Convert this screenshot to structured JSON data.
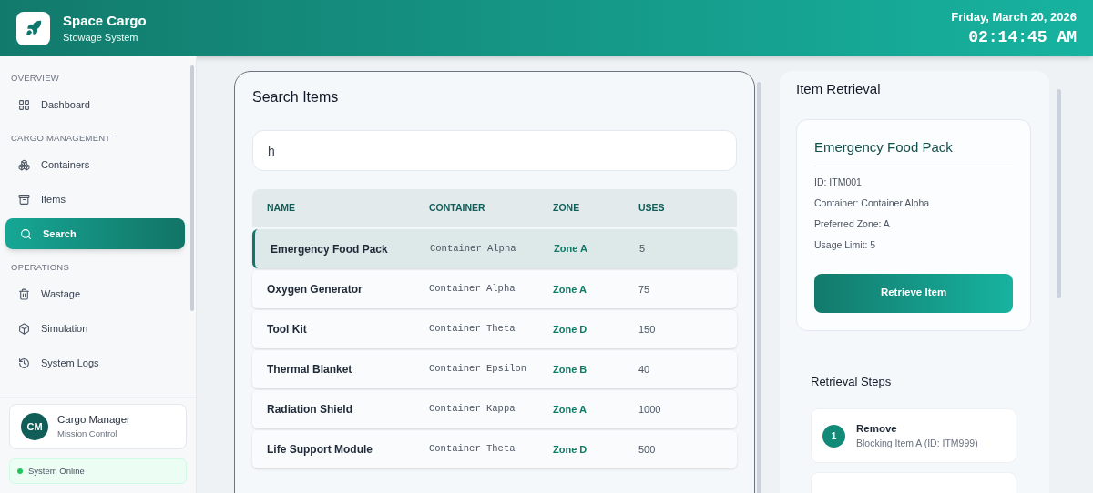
{
  "header": {
    "title": "Space Cargo",
    "subtitle": "Stowage System",
    "date": "Friday, March 20, 2026",
    "time": "02:14:45 AM"
  },
  "sidebar": {
    "sections": [
      {
        "title": "OVERVIEW",
        "items": [
          {
            "label": "Dashboard",
            "selected": false
          }
        ]
      },
      {
        "title": "CARGO MANAGEMENT",
        "items": [
          {
            "label": "Containers",
            "selected": false
          },
          {
            "label": "Items",
            "selected": false
          },
          {
            "label": "Search",
            "selected": true
          }
        ]
      },
      {
        "title": "OPERATIONS",
        "items": [
          {
            "label": "Wastage",
            "selected": false
          },
          {
            "label": "Simulation",
            "selected": false
          },
          {
            "label": "System Logs",
            "selected": false
          }
        ]
      }
    ],
    "user": {
      "initials": "CM",
      "name": "Cargo Manager",
      "role": "Mission Control"
    },
    "status": {
      "label": "System Online",
      "online": true
    }
  },
  "search": {
    "title": "Search Items",
    "value": "h",
    "columns": [
      "NAME",
      "CONTAINER",
      "ZONE",
      "USES"
    ],
    "rows": [
      {
        "name": "Emergency Food Pack",
        "container": "Container Alpha",
        "zone": "Zone A",
        "uses": "5",
        "selected": true
      },
      {
        "name": "Oxygen Generator",
        "container": "Container Alpha",
        "zone": "Zone A",
        "uses": "75",
        "selected": false
      },
      {
        "name": "Tool Kit",
        "container": "Container Theta",
        "zone": "Zone D",
        "uses": "150",
        "selected": false
      },
      {
        "name": "Thermal Blanket",
        "container": "Container Epsilon",
        "zone": "Zone B",
        "uses": "40",
        "selected": false
      },
      {
        "name": "Radiation Shield",
        "container": "Container Kappa",
        "zone": "Zone A",
        "uses": "1000",
        "selected": false
      },
      {
        "name": "Life Support Module",
        "container": "Container Theta",
        "zone": "Zone D",
        "uses": "500",
        "selected": false
      }
    ]
  },
  "retrieval": {
    "title": "Item Retrieval",
    "item": {
      "name": "Emergency Food Pack",
      "details": [
        "ID: ITM001",
        "Container: Container Alpha",
        "Preferred Zone: A",
        "Usage Limit: 5"
      ],
      "button": "Retrieve Item"
    },
    "steps_title": "Retrieval Steps",
    "steps": [
      {
        "number": "1",
        "action": "Remove",
        "detail": "Blocking Item A (ID: ITM999)"
      }
    ]
  }
}
